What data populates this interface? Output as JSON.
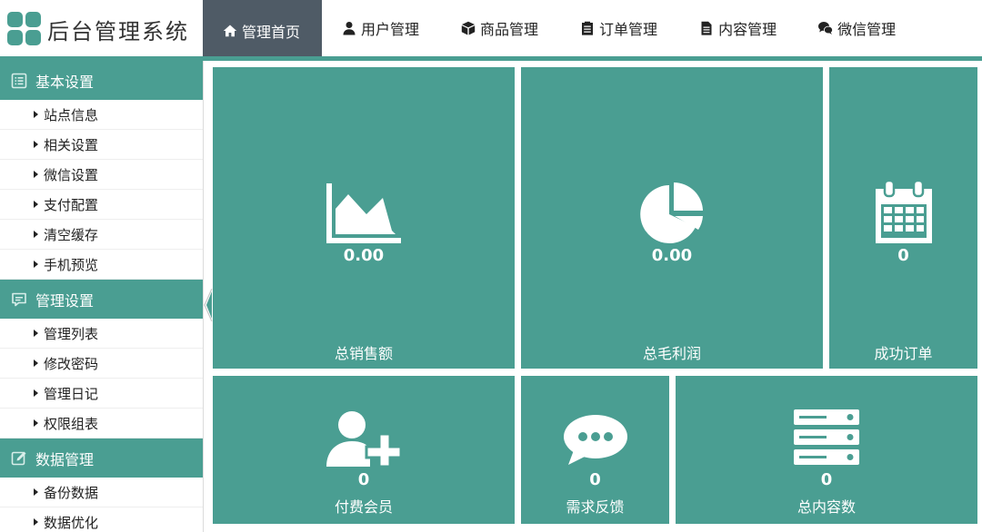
{
  "app": {
    "title": "后台管理系统"
  },
  "nav": {
    "items": [
      {
        "label": "管理首页",
        "icon": "home-icon"
      },
      {
        "label": "用户管理",
        "icon": "user-icon"
      },
      {
        "label": "商品管理",
        "icon": "cube-icon"
      },
      {
        "label": "订单管理",
        "icon": "clipboard-icon"
      },
      {
        "label": "内容管理",
        "icon": "document-icon"
      },
      {
        "label": "微信管理",
        "icon": "wechat-icon"
      }
    ]
  },
  "sidebar": {
    "groups": [
      {
        "title": "基本设置",
        "icon": "list-icon",
        "items": [
          "站点信息",
          "相关设置",
          "微信设置",
          "支付配置",
          "清空缓存",
          "手机预览"
        ]
      },
      {
        "title": "管理设置",
        "icon": "comment-icon",
        "items": [
          "管理列表",
          "修改密码",
          "管理日记",
          "权限组表"
        ]
      },
      {
        "title": "数据管理",
        "icon": "edit-icon",
        "items": [
          "备份数据",
          "数据优化"
        ]
      }
    ]
  },
  "dashboard": {
    "tiles": [
      {
        "label": "总销售额",
        "value": "0.00",
        "icon": "area-chart-icon"
      },
      {
        "label": "总毛利润",
        "value": "0.00",
        "icon": "pie-chart-icon"
      },
      {
        "label": "成功订单",
        "value": "0",
        "icon": "calendar-icon"
      },
      {
        "label": "付费会员",
        "value": "0",
        "icon": "user-add-icon"
      },
      {
        "label": "需求反馈",
        "value": "0",
        "icon": "chat-bubble-icon"
      },
      {
        "label": "总内容数",
        "value": "0",
        "icon": "server-icon"
      }
    ]
  },
  "colors": {
    "accent": "#4a9e92",
    "nav_active": "#4f5b66",
    "background": "#ffffff"
  }
}
